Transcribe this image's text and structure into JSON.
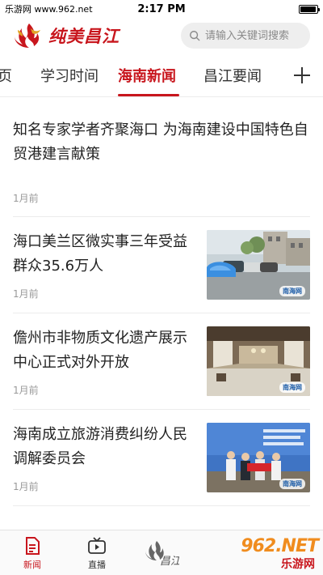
{
  "status_bar": {
    "carrier": "乐游网 www.962.net",
    "time": "2:17 PM",
    "battery_level": 0.95
  },
  "header": {
    "logo_text": "纯美昌江",
    "search_placeholder": "请输入关键词搜索"
  },
  "tabs": [
    {
      "label": "首页",
      "visible_label": "i页"
    },
    {
      "label": "学习时间"
    },
    {
      "label": "海南新闻",
      "active": true
    },
    {
      "label": "昌江要闻"
    }
  ],
  "news": [
    {
      "title": "知名专家学者齐聚海口 为海南建设中国特色自贸港建言献策",
      "time": "1月前"
    },
    {
      "title": "海口美兰区微实事三年受益群众35.6万人",
      "time": "1月前",
      "thumb_watermark": "南海网"
    },
    {
      "title": "儋州市非物质文化遗产展示中心正式对外开放",
      "time": "1月前",
      "thumb_watermark": "南海网"
    },
    {
      "title": "海南成立旅游消费纠纷人民调解委员会",
      "time": "1月前",
      "thumb_watermark": "南海网"
    }
  ],
  "bottom_nav": [
    {
      "label": "新闻",
      "icon": "news-icon",
      "active": true
    },
    {
      "label": "直播",
      "icon": "tv-icon"
    },
    {
      "label": "昌江云",
      "icon": "changjiang-logo-icon"
    }
  ],
  "site_badge": {
    "text": "962.NET",
    "sub": "乐游网"
  },
  "colors": {
    "accent": "#c8161d",
    "muted": "#999999",
    "divider": "#ececec"
  }
}
